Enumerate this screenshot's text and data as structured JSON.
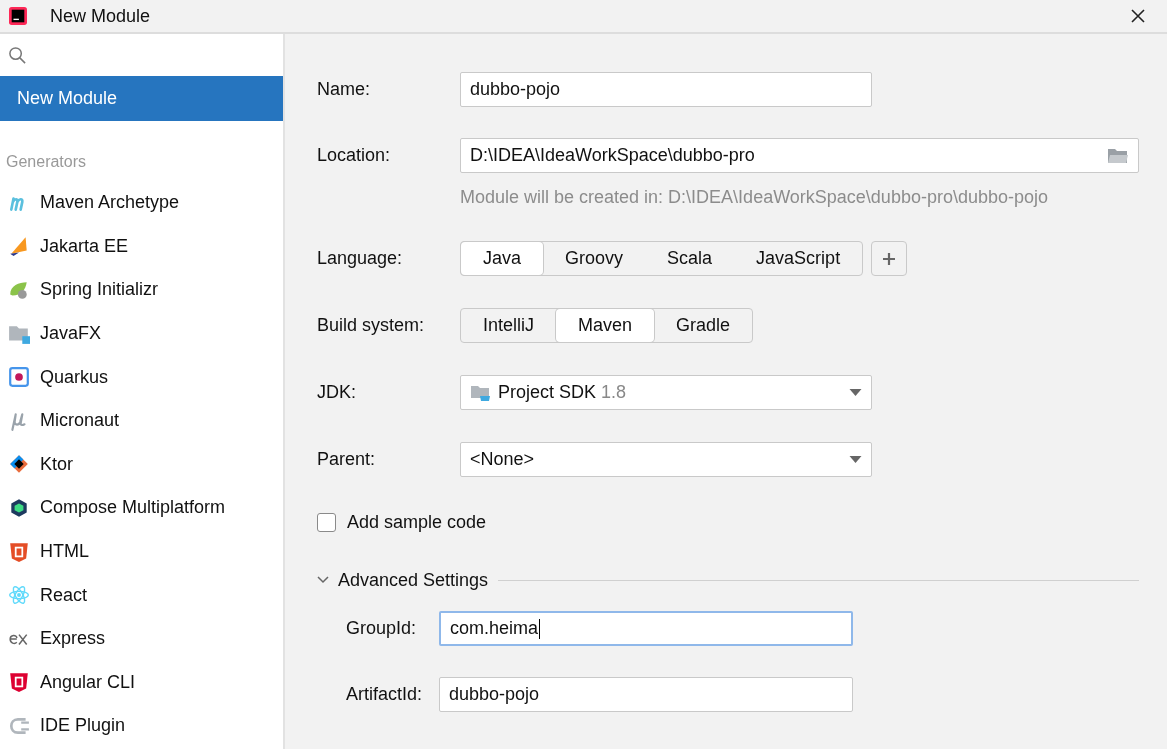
{
  "window": {
    "title": "New Module"
  },
  "sidebar": {
    "items": [
      {
        "label": "New Module",
        "selected": true
      }
    ],
    "section_title": "Generators",
    "generators": [
      {
        "label": "Maven Archetype",
        "selected": false
      },
      {
        "label": "Jakarta EE",
        "selected": false
      },
      {
        "label": "Spring Initializr",
        "selected": false
      },
      {
        "label": "JavaFX",
        "selected": false
      },
      {
        "label": "Quarkus",
        "selected": false
      },
      {
        "label": "Micronaut",
        "selected": false
      },
      {
        "label": "Ktor",
        "selected": false
      },
      {
        "label": "Compose Multiplatform",
        "selected": false
      },
      {
        "label": "HTML",
        "selected": false
      },
      {
        "label": "React",
        "selected": false
      },
      {
        "label": "Express",
        "selected": false
      },
      {
        "label": "Angular CLI",
        "selected": false
      },
      {
        "label": "IDE Plugin",
        "selected": false
      }
    ]
  },
  "form": {
    "name": {
      "label": "Name:",
      "value": "dubbo-pojo"
    },
    "location": {
      "label": "Location:",
      "value": "D:\\IDEA\\IdeaWorkSpace\\dubbo-pro",
      "hint": "Module will be created in: D:\\IDEA\\IdeaWorkSpace\\dubbo-pro\\dubbo-pojo"
    },
    "language": {
      "label": "Language:",
      "options": [
        {
          "label": "Java",
          "selected": true
        },
        {
          "label": "Groovy",
          "selected": false
        },
        {
          "label": "Scala",
          "selected": false
        },
        {
          "label": "JavaScript",
          "selected": false
        }
      ]
    },
    "build_system": {
      "label": "Build system:",
      "options": [
        {
          "label": "IntelliJ",
          "selected": false
        },
        {
          "label": "Maven",
          "selected": true
        },
        {
          "label": "Gradle",
          "selected": false
        }
      ]
    },
    "jdk": {
      "label": "JDK:",
      "value": "Project SDK",
      "version": "1.8"
    },
    "parent": {
      "label": "Parent:",
      "value": "<None>"
    },
    "sample_code": {
      "label": "Add sample code",
      "checked": false
    },
    "advanced": {
      "label": "Advanced Settings",
      "expanded": true,
      "group_id": {
        "label": "GroupId:",
        "value": "com.heima",
        "focused": true
      },
      "artifact_id": {
        "label": "ArtifactId:",
        "value": "dubbo-pojo",
        "focused": false
      }
    }
  }
}
